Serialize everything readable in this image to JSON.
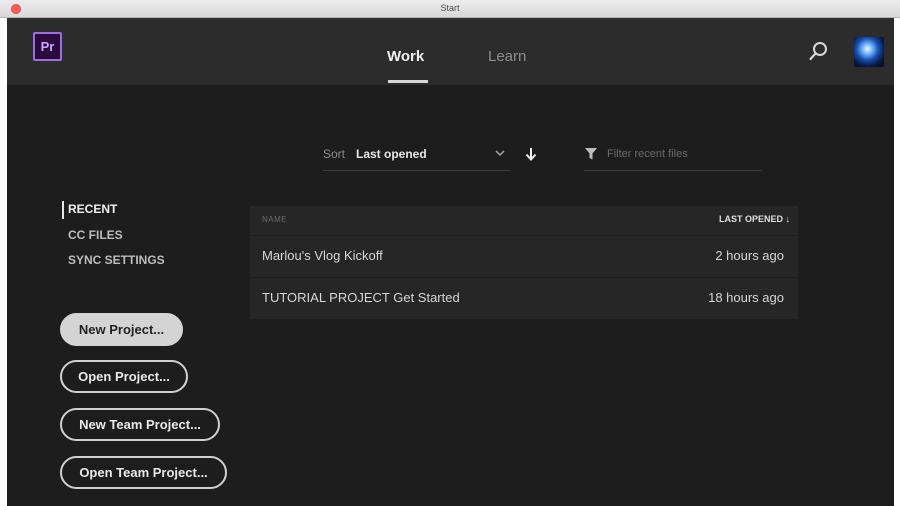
{
  "window": {
    "title": "Start"
  },
  "app": {
    "logo_text": "Pr",
    "logo_color": "#9b6fe0"
  },
  "tabs": [
    {
      "label": "Work",
      "active": true
    },
    {
      "label": "Learn",
      "active": false
    }
  ],
  "toolbar": {
    "search_icon": "search-icon",
    "avatar_icon": "user-avatar"
  },
  "sort": {
    "label": "Sort",
    "value": "Last opened",
    "dropdown_icon": "chevron-down-icon",
    "order_icon": "arrow-down-icon"
  },
  "filter": {
    "placeholder": "Filter recent files",
    "icon": "filter-icon"
  },
  "sidebar": {
    "items": [
      {
        "label": "RECENT",
        "active": true
      },
      {
        "label": "CC FILES",
        "active": false
      },
      {
        "label": "SYNC SETTINGS",
        "active": false
      }
    ]
  },
  "buttons": {
    "new_project": "New Project...",
    "open_project": "Open Project...",
    "new_team_project": "New Team Project...",
    "open_team_project": "Open Team Project..."
  },
  "table": {
    "columns": [
      "NAME",
      "LAST OPENED ↓"
    ],
    "rows": [
      {
        "name": "Marlou's Vlog Kickoff",
        "last_opened": "2 hours ago"
      },
      {
        "name": "TUTORIAL PROJECT Get Started",
        "last_opened": "18 hours ago"
      }
    ]
  },
  "colors": {
    "background": "#1d1d1d",
    "topbar": "#2c2c2c",
    "row": "#262626",
    "text": "#d6d6d6"
  }
}
